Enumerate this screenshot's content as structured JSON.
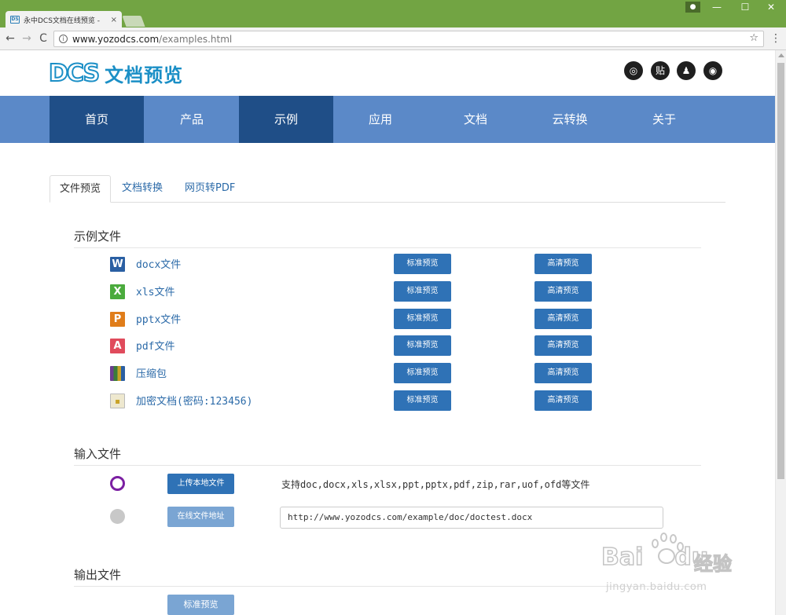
{
  "browser": {
    "tab_title": "永中DCS文档在线预览 -",
    "tab_close": "×",
    "favicon_text": "DS",
    "url_host": "www.yozodcs.com",
    "url_path": "/examples.html",
    "icons": [
      "back-icon",
      "forward-icon",
      "reload-icon",
      "info-icon",
      "star-icon",
      "menu-icon",
      "user-icon",
      "minimize-icon",
      "maximize-icon",
      "close-icon"
    ],
    "glyphs": {
      "back": "←",
      "forward": "→",
      "reload": "C",
      "info": "i",
      "star": "☆",
      "menu": "⋮",
      "user": "●",
      "minimize": "—",
      "maximize": "☐",
      "close": "✕"
    }
  },
  "site": {
    "logo_mark": "DCS",
    "logo_text": "文档预览",
    "social": [
      {
        "name": "wechat-icon",
        "glyph": "◎"
      },
      {
        "name": "tieba-icon",
        "glyph": "贴"
      },
      {
        "name": "qq-icon",
        "glyph": "♟"
      },
      {
        "name": "weibo-icon",
        "glyph": "◉"
      }
    ]
  },
  "nav": {
    "items": [
      "首页",
      "产品",
      "示例",
      "应用",
      "文档",
      "云转换",
      "关于"
    ],
    "active": "示例"
  },
  "tabs": [
    "文件预览",
    "文档转换",
    "网页转PDF"
  ],
  "sections": {
    "examples_title": "示例文件",
    "input_title": "输入文件",
    "output_title": "输出文件"
  },
  "examples": [
    {
      "label": "docx文件",
      "icon": "word-icon",
      "color": "#2a5fa3",
      "glyph": "W"
    },
    {
      "label": "xls文件",
      "icon": "excel-icon",
      "color": "#4bab3d",
      "glyph": "X"
    },
    {
      "label": "pptx文件",
      "icon": "ppt-icon",
      "color": "#e07d1a",
      "glyph": "P"
    },
    {
      "label": "pdf文件",
      "icon": "pdf-icon",
      "color": "#e04b5c",
      "glyph": "A"
    },
    {
      "label": "压缩包",
      "icon": "archive-icon",
      "color": "#6b3e8f",
      "glyph": "▥"
    },
    {
      "label": "加密文档(密码:123456)",
      "icon": "locked-doc-icon",
      "color": "#d9c98a",
      "glyph": "🔒"
    }
  ],
  "buttons": {
    "standard_preview": "标准预览",
    "hd_preview": "高清预览",
    "upload_local": "上传本地文件",
    "online_url": "在线文件地址"
  },
  "input": {
    "support_text": "支持doc,docx,xls,xlsx,ppt,pptx,pdf,zip,rar,uof,ofd等文件",
    "url_value": "http://www.yozodcs.com/example/doc/doctest.docx"
  },
  "output": {
    "button": "标准预览"
  },
  "watermark": {
    "brand": "Bai",
    "brand2": "du",
    "suffix": "经验",
    "url": "jingyan.baidu.com"
  },
  "colors": {
    "chrome": "#72a443",
    "nav": "#5b89c8",
    "nav_active": "#1f4e87",
    "button": "#2f72b6",
    "button_disabled": "#7aa5d3",
    "link": "#2b6aa8"
  }
}
